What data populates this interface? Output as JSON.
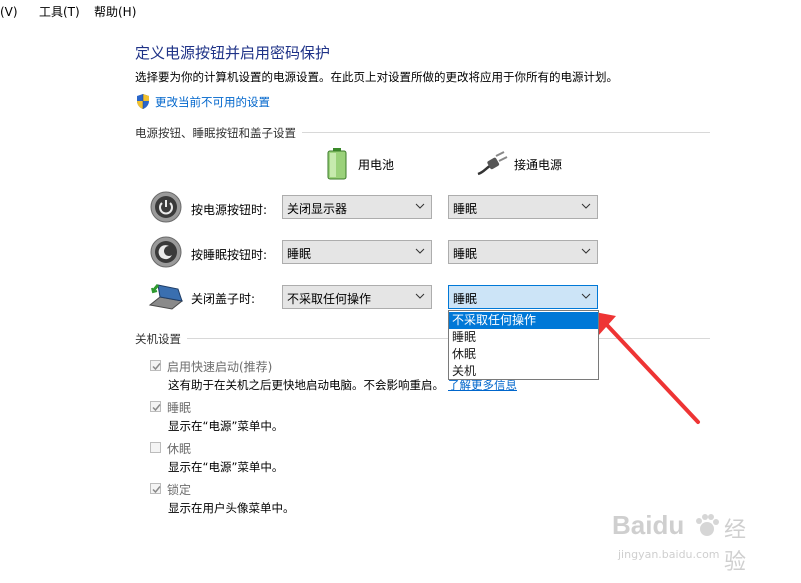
{
  "menu": {
    "view": "看(V)",
    "tools": "工具(T)",
    "help": "帮助(H)"
  },
  "header": {
    "title": "定义电源按钮并启用密码保护",
    "description": "选择要为你的计算机设置的电源设置。在此页上对设置所做的更改将应用于你所有的电源计划。",
    "change_link": "更改当前不可用的设置"
  },
  "power_section": {
    "heading": "电源按钮、睡眠按钮和盖子设置",
    "col_battery": "用电池",
    "col_plugged": "接通电源",
    "rows": [
      {
        "label": "按电源按钮时:",
        "battery": "关闭显示器",
        "plugged": "睡眠"
      },
      {
        "label": "按睡眠按钮时:",
        "battery": "睡眠",
        "plugged": "睡眠"
      },
      {
        "label": "关闭盖子时:",
        "battery": "不采取任何操作",
        "plugged": "睡眠"
      }
    ]
  },
  "dropdown": {
    "options": [
      "不采取任何操作",
      "睡眠",
      "休眠",
      "关机"
    ],
    "highlighted_index": 0
  },
  "shutdown_section": {
    "heading": "关机设置",
    "items": [
      {
        "label": "启用快速启动(推荐)",
        "checked": true,
        "desc": "这有助于在关机之后更快地启动电脑。不会影响重启。",
        "link": "了解更多信息"
      },
      {
        "label": "睡眠",
        "checked": true,
        "desc": "显示在“电源”菜单中。"
      },
      {
        "label": "休眠",
        "checked": false,
        "desc": "显示在“电源”菜单中。"
      },
      {
        "label": "锁定",
        "checked": true,
        "desc": "显示在用户头像菜单中。"
      }
    ]
  },
  "watermark": {
    "brand": "Baidu",
    "product": "经验",
    "url": "jingyan.baidu.com"
  },
  "colors": {
    "title": "#1e3287",
    "link": "#0066cc",
    "highlight": "#0078d7",
    "arrow": "#ee3434"
  }
}
